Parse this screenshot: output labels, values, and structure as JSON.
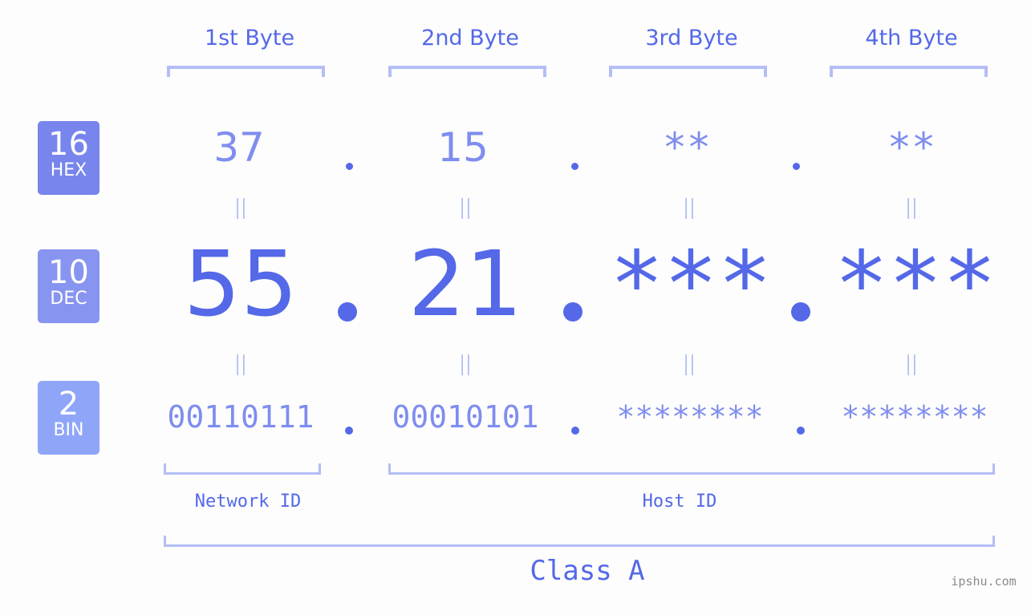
{
  "bytes": [
    "1st Byte",
    "2nd Byte",
    "3rd Byte",
    "4th Byte"
  ],
  "badges": {
    "hex": {
      "num": "16",
      "label": "HEX",
      "color": "#7785ec"
    },
    "dec": {
      "num": "10",
      "label": "DEC",
      "color": "#8794f0"
    },
    "bin": {
      "num": "2",
      "label": "BIN",
      "color": "#8fa5f8"
    }
  },
  "hex_values": [
    "37",
    "15",
    "**",
    "**"
  ],
  "dec_values": [
    "55",
    "21",
    "***",
    "***"
  ],
  "bin_values": [
    "00110111",
    "00010101",
    "********",
    "********"
  ],
  "equals": "=",
  "network_label": "Network ID",
  "host_label": "Host ID",
  "class_label": "Class A",
  "watermark": "ipshu.com"
}
